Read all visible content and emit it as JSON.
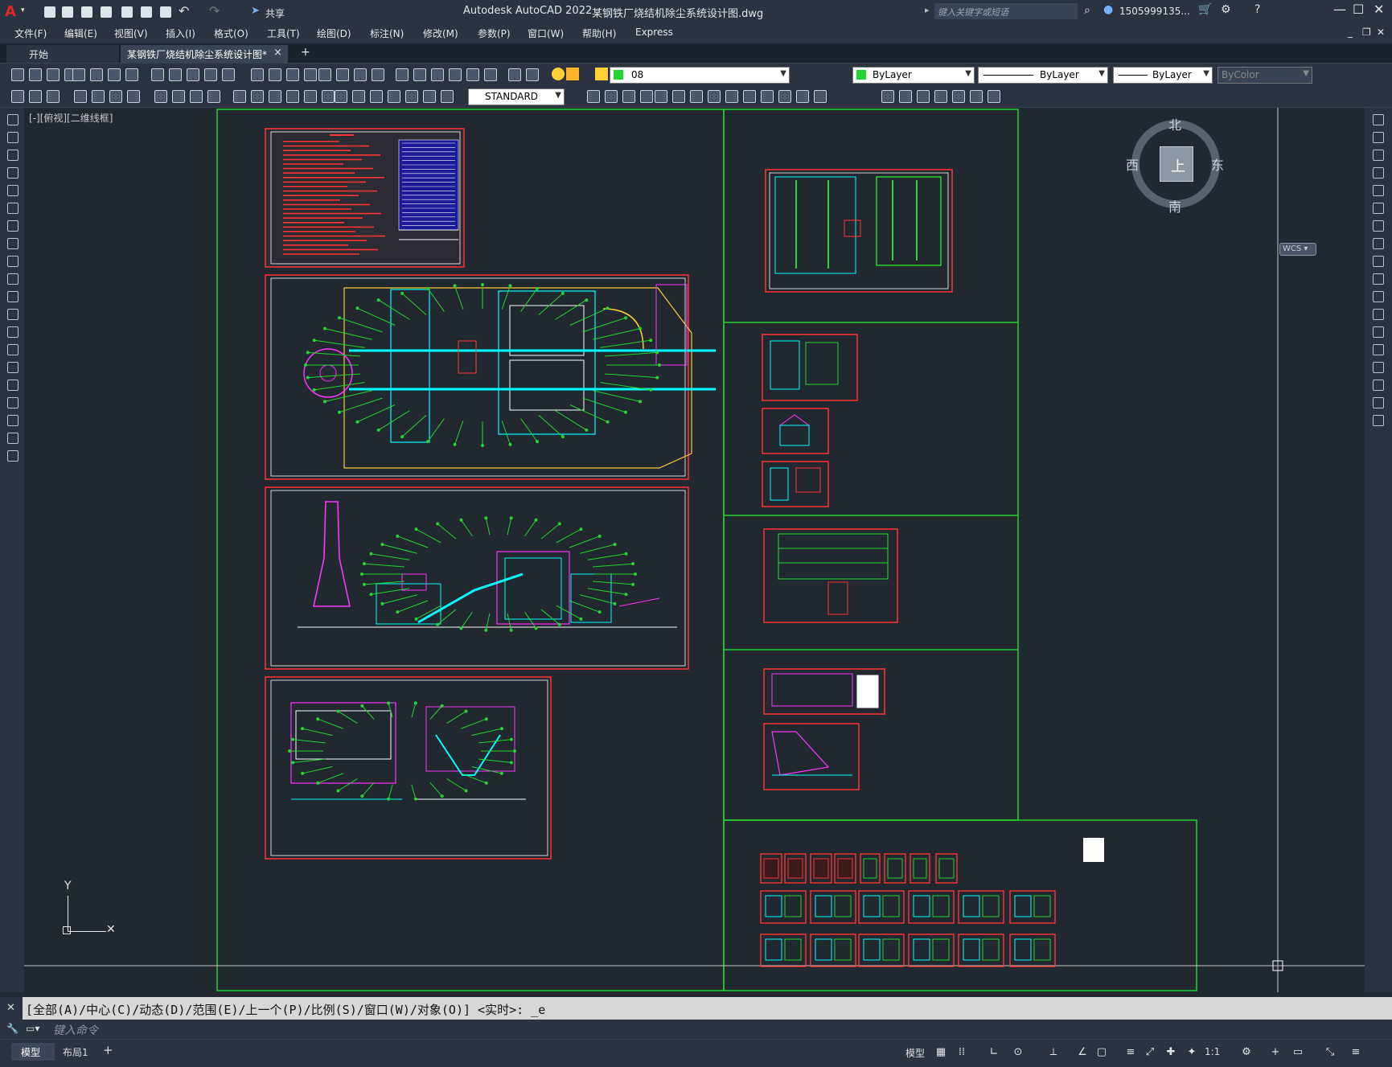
{
  "window": {
    "app_title": "Autodesk AutoCAD 2022",
    "file_name": "某钢铁厂烧结机除尘系统设计图.dwg",
    "search_placeholder": "键入关键字或短语",
    "user": "1505999135...",
    "share_label": "共享"
  },
  "menu": [
    "文件(F)",
    "编辑(E)",
    "视图(V)",
    "插入(I)",
    "格式(O)",
    "工具(T)",
    "绘图(D)",
    "标注(N)",
    "修改(M)",
    "参数(P)",
    "窗口(W)",
    "帮助(H)",
    "Express"
  ],
  "tabs": {
    "start": "开始",
    "active": "某钢铁厂烧结机除尘系统设计图*",
    "close": "×",
    "add": "+"
  },
  "toolbar": {
    "layer_value": "08",
    "color_value": "ByLayer",
    "linetype_value": "ByLayer",
    "lineweight_value": "ByLayer",
    "plotstyle_value": "ByColor",
    "textstyle_value": "STANDARD"
  },
  "viewport": {
    "label": "[-][俯视][二维线框]",
    "compass": {
      "north": "北",
      "south": "南",
      "east": "东",
      "west": "西",
      "top": "上"
    },
    "wcs_label": "WCS",
    "ucs_y": "Y"
  },
  "command": {
    "history": "[全部(A)/中心(C)/动态(D)/范围(E)/上一个(P)/比例(S)/窗口(W)/对象(O)] <实时>: _e",
    "placeholder": "键入命令"
  },
  "status": {
    "model_tab": "模型",
    "layout_tab": "布局1",
    "model_btn": "模型",
    "scale": "1:1"
  },
  "colors": {
    "border_green": "#21d62e",
    "sheet_red": "#ff3333",
    "cyan": "#00ffff",
    "magenta": "#ff33ff",
    "yellow": "#ffcc33"
  }
}
